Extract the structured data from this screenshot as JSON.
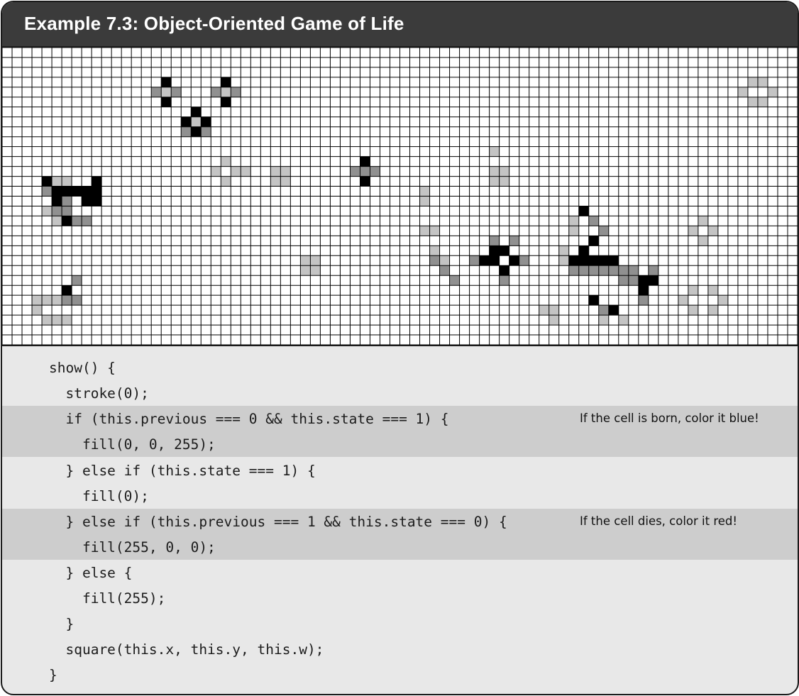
{
  "title": "Example 7.3: Object-Oriented Game of Life",
  "grid": {
    "cols": 80,
    "rows": 30,
    "colors": {
      "born": "#909090",
      "alive": "#000000",
      "died": "#c4c4c4",
      "dead": "#ffffff",
      "line": "#000000"
    },
    "cells": {
      "alive": [
        [
          16,
          3
        ],
        [
          22,
          3
        ],
        [
          16,
          5
        ],
        [
          22,
          5
        ],
        [
          19,
          6
        ],
        [
          18,
          7
        ],
        [
          20,
          7
        ],
        [
          19,
          8
        ],
        [
          36,
          11
        ],
        [
          36,
          13
        ],
        [
          5,
          14
        ],
        [
          6,
          14
        ],
        [
          7,
          14
        ],
        [
          8,
          14
        ],
        [
          9,
          14
        ],
        [
          4,
          13
        ],
        [
          9,
          13
        ],
        [
          5,
          15
        ],
        [
          8,
          15
        ],
        [
          9,
          15
        ],
        [
          6,
          17
        ],
        [
          49,
          20
        ],
        [
          50,
          20
        ],
        [
          48,
          21
        ],
        [
          49,
          21
        ],
        [
          51,
          21
        ],
        [
          50,
          22
        ],
        [
          58,
          16
        ],
        [
          59,
          19
        ],
        [
          58,
          20
        ],
        [
          57,
          21
        ],
        [
          58,
          21
        ],
        [
          59,
          21
        ],
        [
          60,
          21
        ],
        [
          61,
          21
        ],
        [
          64,
          23
        ],
        [
          65,
          23
        ],
        [
          64,
          24
        ],
        [
          59,
          25
        ],
        [
          61,
          26
        ],
        [
          6,
          24
        ]
      ],
      "born": [
        [
          15,
          4
        ],
        [
          17,
          4
        ],
        [
          21,
          4
        ],
        [
          23,
          4
        ],
        [
          18,
          8
        ],
        [
          20,
          8
        ],
        [
          36,
          12
        ],
        [
          35,
          12
        ],
        [
          37,
          12
        ],
        [
          4,
          14
        ],
        [
          6,
          15
        ],
        [
          6,
          16
        ],
        [
          7,
          17
        ],
        [
          8,
          17
        ],
        [
          5,
          16
        ],
        [
          43,
          21
        ],
        [
          44,
          22
        ],
        [
          45,
          23
        ],
        [
          49,
          19
        ],
        [
          51,
          19
        ],
        [
          50,
          23
        ],
        [
          52,
          21
        ],
        [
          47,
          21
        ],
        [
          59,
          17
        ],
        [
          60,
          18
        ],
        [
          63,
          22
        ],
        [
          62,
          23
        ],
        [
          57,
          22
        ],
        [
          58,
          22
        ],
        [
          59,
          22
        ],
        [
          60,
          22
        ],
        [
          61,
          22
        ],
        [
          62,
          22
        ],
        [
          63,
          23
        ],
        [
          65,
          22
        ],
        [
          60,
          26
        ],
        [
          64,
          25
        ],
        [
          7,
          23
        ],
        [
          6,
          25
        ],
        [
          7,
          25
        ]
      ],
      "died": [
        [
          16,
          4
        ],
        [
          22,
          4
        ],
        [
          19,
          7
        ],
        [
          49,
          10
        ],
        [
          49,
          12
        ],
        [
          50,
          12
        ],
        [
          49,
          13
        ],
        [
          50,
          13
        ],
        [
          22,
          11
        ],
        [
          21,
          12
        ],
        [
          23,
          12
        ],
        [
          22,
          13
        ],
        [
          24,
          12
        ],
        [
          27,
          12
        ],
        [
          28,
          12
        ],
        [
          27,
          13
        ],
        [
          28,
          13
        ],
        [
          42,
          14
        ],
        [
          42,
          15
        ],
        [
          42,
          18
        ],
        [
          43,
          18
        ],
        [
          43,
          20
        ],
        [
          44,
          21
        ],
        [
          30,
          22
        ],
        [
          31,
          22
        ],
        [
          30,
          21
        ],
        [
          31,
          21
        ],
        [
          6,
          13
        ],
        [
          5,
          13
        ],
        [
          4,
          16
        ],
        [
          5,
          16
        ],
        [
          5,
          17
        ],
        [
          4,
          25
        ],
        [
          5,
          25
        ],
        [
          3,
          26
        ],
        [
          4,
          27
        ],
        [
          5,
          27
        ],
        [
          6,
          27
        ],
        [
          3,
          25
        ],
        [
          75,
          3
        ],
        [
          76,
          3
        ],
        [
          74,
          4
        ],
        [
          77,
          4
        ],
        [
          75,
          5
        ],
        [
          76,
          5
        ],
        [
          70,
          17
        ],
        [
          69,
          18
        ],
        [
          71,
          18
        ],
        [
          70,
          19
        ],
        [
          69,
          24
        ],
        [
          71,
          24
        ],
        [
          68,
          25
        ],
        [
          72,
          25
        ],
        [
          69,
          26
        ],
        [
          71,
          26
        ],
        [
          54,
          26
        ],
        [
          55,
          26
        ],
        [
          55,
          27
        ],
        [
          60,
          27
        ],
        [
          62,
          27
        ],
        [
          56,
          21
        ],
        [
          57,
          17
        ],
        [
          57,
          18
        ],
        [
          56,
          20
        ]
      ]
    }
  },
  "code_lines": [
    "show() {",
    "  stroke(0);",
    "  if (this.previous === 0 && this.state === 1) {",
    "    fill(0, 0, 255);",
    "  } else if (this.state === 1) {",
    "    fill(0);",
    "  } else if (this.previous === 1 && this.state === 0) {",
    "    fill(255, 0, 0);",
    "  } else {",
    "    fill(255);",
    "  }",
    "  square(this.x, this.y, this.w);",
    "}"
  ],
  "highlighted_lines": [
    2,
    3,
    6,
    7
  ],
  "annotations": [
    {
      "line": 2,
      "text": "If the cell is born, color it blue!"
    },
    {
      "line": 6,
      "text": "If the cell dies, color it red!"
    }
  ],
  "code_colors": {
    "highlight": "#cdcdcd",
    "background": "#e8e8e8"
  }
}
